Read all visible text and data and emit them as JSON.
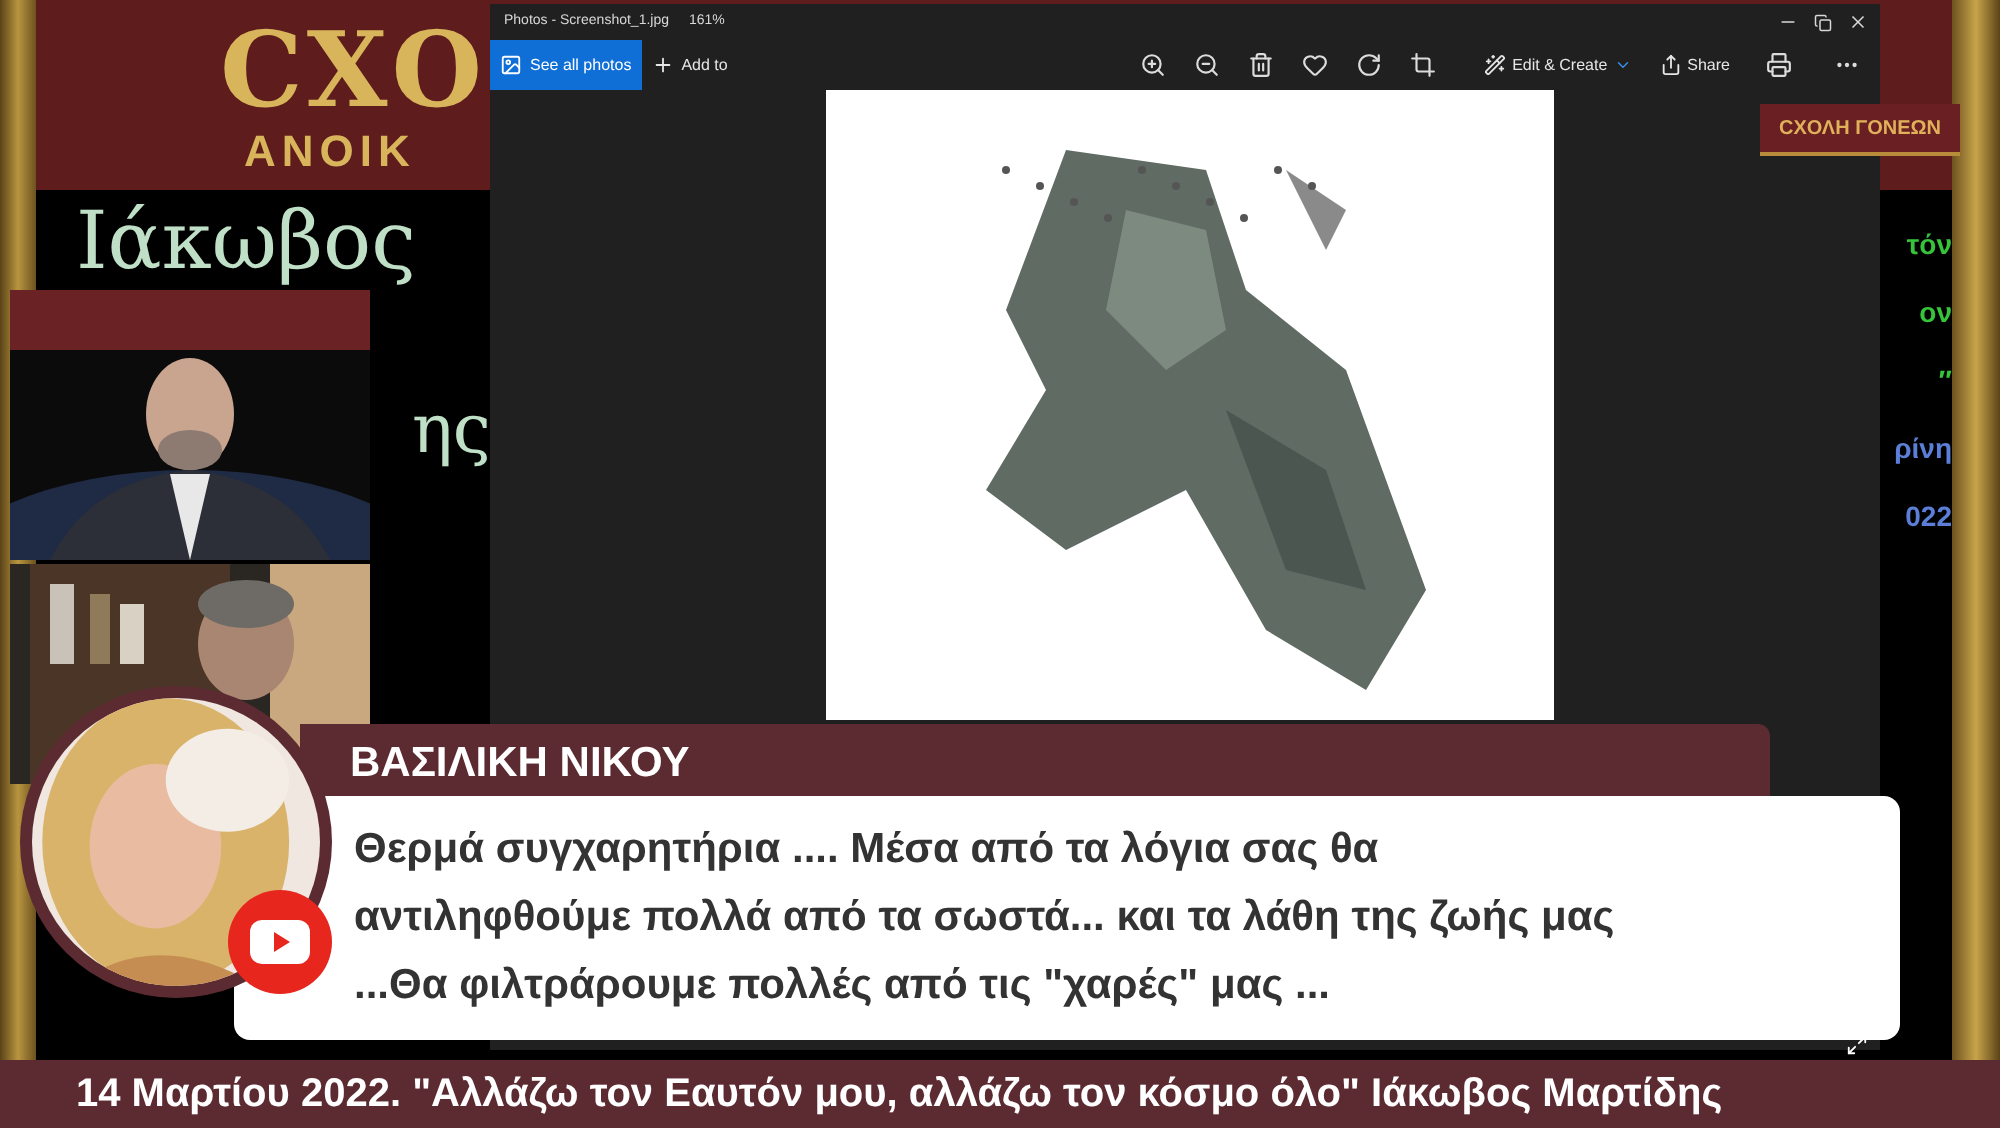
{
  "backdrop": {
    "title": "ϹΧΟ",
    "subtitle": "ΑΝΟΙΚ",
    "name": "Ιάκωβος",
    "name_end": "ης",
    "right_lines": [
      {
        "text": "τόν",
        "color": "#35c43a"
      },
      {
        "text": "ον",
        "color": "#35c43a"
      },
      {
        "text": "″",
        "color": "#35c43a"
      },
      {
        "text": "ρίνη",
        "color": "#5b7fd6"
      },
      {
        "text": "022",
        "color": "#5b7fd6"
      }
    ]
  },
  "logo": {
    "text": "ϹΧΟΛΗ ΓΟΝΕΩΝ"
  },
  "photos_window": {
    "title": "Photos - Screenshot_1.jpg",
    "zoom": "161%",
    "left_buttons": [
      {
        "label": "See all photos",
        "kind": "primary"
      },
      {
        "label": "Add to",
        "kind": "plain"
      }
    ],
    "right_buttons": [
      {
        "label": "Edit & Create",
        "kind": "edit"
      },
      {
        "label": "Share",
        "kind": "share"
      }
    ]
  },
  "comment": {
    "author": "ΒΑΣΙΛΙΚΗ ΝΙΚΟΥ",
    "lines": [
      "Θερμά συγχαρητήρια .... Μέσα από τα λόγια σας θα",
      "αντιληφθούμε πολλά από τα σωστά... και τα λάθη της ζωής μας",
      "...Θα φιλτράρουμε πολλές από τις \"χαρές\" μας ..."
    ]
  },
  "ticker": "14 Μαρτίου 2022. \"Αλλάζω τον Εαυτόν μου, αλλάζω τον κόσμο όλο\" Ιάκωβος Μαρτίδης"
}
